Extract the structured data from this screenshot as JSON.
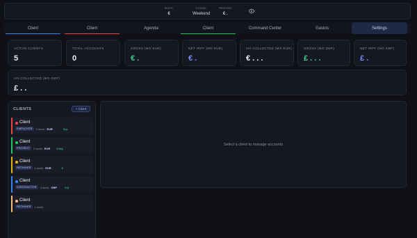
{
  "topbar": {
    "rate_label": "RATE",
    "rate_value": "€",
    "today_label": "TODAY",
    "today_value": "Weekend",
    "period_label": "PERIOD",
    "period_value": "€ ."
  },
  "tabs": [
    {
      "label": "Client",
      "accent": "#3b82f6"
    },
    {
      "label": "Client",
      "accent": "#ef4444"
    },
    {
      "label": "Agenda",
      "accent": ""
    },
    {
      "label": "Client",
      "accent": "#22c55e"
    },
    {
      "label": "Command Center",
      "accent": ""
    },
    {
      "label": "Gastos",
      "accent": ""
    },
    {
      "label": "Settings",
      "accent": "",
      "active": true
    }
  ],
  "stats": {
    "active_clients_label": "ACTIVE CLIENTS",
    "active_clients_value": "5",
    "total_accounts_label": "TOTAL ACCOUNTS",
    "total_accounts_value": "0",
    "gross_eur_label": "GROSS (MO EUR)",
    "gross_eur_value": "€ .",
    "net_irpf_eur_label": "NET IRPF (MO EUR)",
    "net_irpf_eur_value": "€ .",
    "iva_eur_label": "IVA COLLECTED (MO EUR)",
    "iva_eur_value": "€ . . .",
    "gross_gbp_label": "GROSS (MO GBP)",
    "gross_gbp_value": "£ . . .",
    "net_irpf_gbp_label": "NET IRPF (MO GBP)",
    "net_irpf_gbp_value": "£ .",
    "iva_gbp_label": "IVA COLLECTED (MO GBP)",
    "iva_gbp_value": "£ . ."
  },
  "sidebar": {
    "title": "CLIENTS",
    "add_button": "+ Client",
    "clients": [
      {
        "name": "Client",
        "badge": "EMPLOYER",
        "accounts": "3 accts",
        "currency": "EUR",
        "amount": "€/yr",
        "color": "#ef4444"
      },
      {
        "name": "Client",
        "badge": "PROJECT",
        "accounts": "3 accts",
        "currency": "EUR",
        "amount": "€/day",
        "color": "#22c55e"
      },
      {
        "name": "Client",
        "badge": "RETAINER",
        "accounts": "0 accts",
        "currency": "EUR",
        "amount": "€",
        "color": "#eab308"
      },
      {
        "name": "Client",
        "badge": "CONTRACTOR",
        "accounts": "3 accts",
        "currency": "GBP",
        "amount": "£/yr",
        "color": "#3b82f6"
      },
      {
        "name": "Client",
        "badge": "RETAINER",
        "accounts": "1 accts",
        "currency": "",
        "amount": "",
        "color": "#fdba74"
      }
    ]
  },
  "main": {
    "empty_message": "Select a client to manage accounts"
  }
}
